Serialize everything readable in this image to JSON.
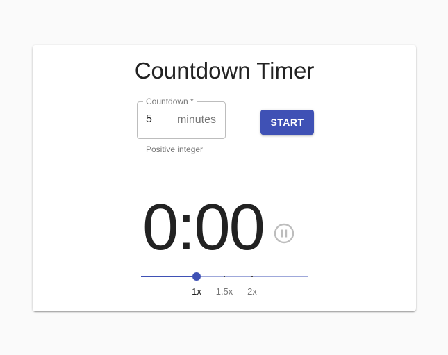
{
  "app": {
    "title": "Countdown Timer"
  },
  "countdown_field": {
    "label": "Countdown *",
    "value": "5",
    "unit": "minutes",
    "helper_text": "Positive integer"
  },
  "start_button": {
    "label": "START"
  },
  "timer": {
    "display": "0:00",
    "pause_icon": "pause-circle-outline-icon"
  },
  "speed": {
    "value": "1x",
    "marks": [
      {
        "label": "1x",
        "value": 1
      },
      {
        "label": "1.5x",
        "value": 1.5
      },
      {
        "label": "2x",
        "value": 2
      }
    ],
    "min": 0,
    "max": 3
  },
  "colors": {
    "primary": "#3f51b5",
    "rail": "#9fa8da",
    "text": "#222222",
    "muted": "#757575",
    "icon": "#bdbdbd"
  }
}
